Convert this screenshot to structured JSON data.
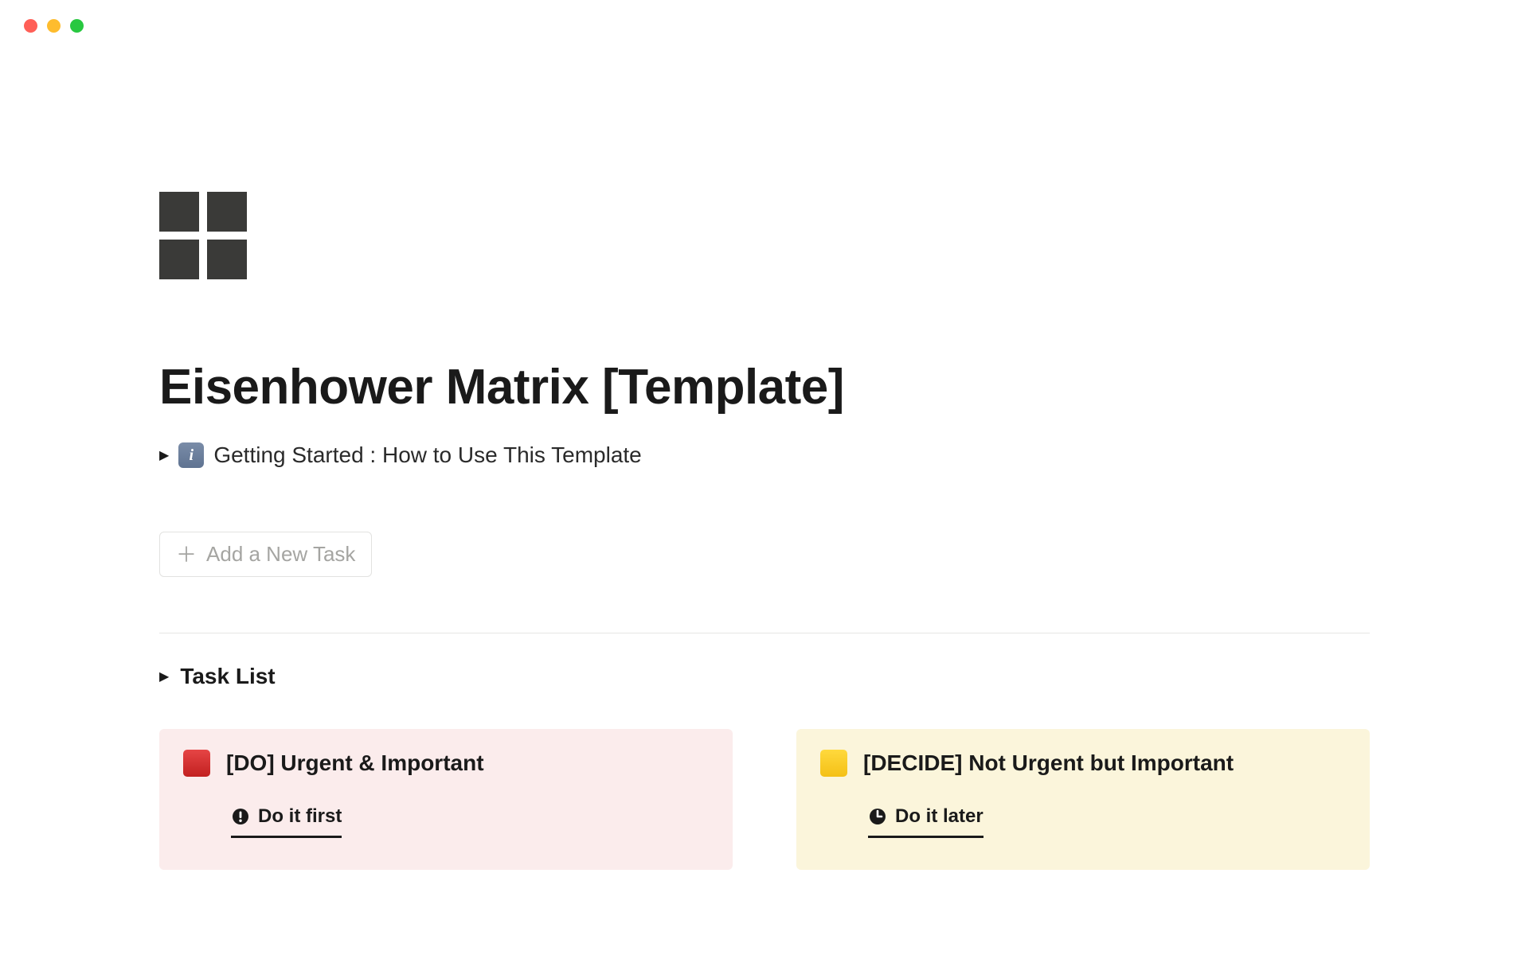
{
  "page": {
    "title": "Eisenhower Matrix [Template]"
  },
  "getting_started": {
    "label": "Getting Started : How to Use This Template"
  },
  "add_task": {
    "label": "Add a New Task"
  },
  "task_list": {
    "label": "Task List"
  },
  "quadrants": {
    "do": {
      "title": "[DO]  Urgent & Important",
      "tab": "Do it first"
    },
    "decide": {
      "title": "[DECIDE]  Not Urgent but Important",
      "tab": "Do it later"
    }
  }
}
